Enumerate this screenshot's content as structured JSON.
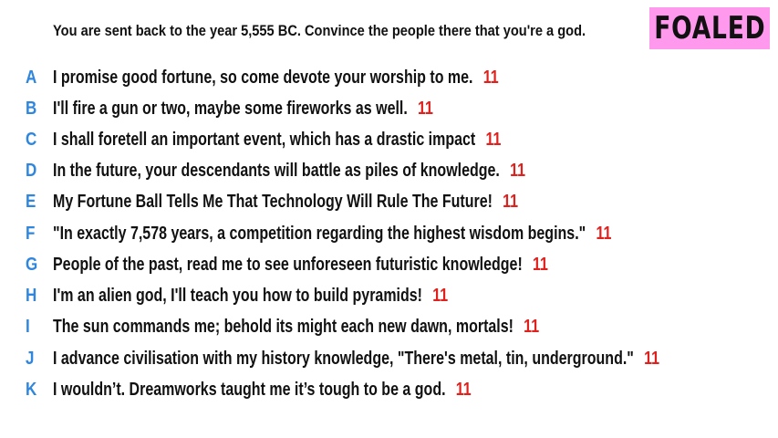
{
  "prompt": "You are sent back to the year 5,555 BC. Convince the people there that you're a god.",
  "badge": "FOALED",
  "colors": {
    "letter": "#2e86de",
    "score": "#e0201c",
    "badge_bg": "#ff99ee"
  },
  "answers": [
    {
      "letter": "A",
      "text": "I promise good fortune, so come devote your worship to me.",
      "score": "11"
    },
    {
      "letter": "B",
      "text": "I'll fire a gun or two, maybe some fireworks as well.",
      "score": "11"
    },
    {
      "letter": "C",
      "text": "I shall foretell an important event, which has a drastic impact",
      "score": "11"
    },
    {
      "letter": "D",
      "text": "In the future, your descendants will battle as piles of knowledge.",
      "score": "11"
    },
    {
      "letter": "E",
      "text": "My Fortune Ball Tells Me That Technology Will Rule The Future!",
      "score": "11"
    },
    {
      "letter": "F",
      "text": "\"In exactly 7,578 years, a competition regarding the highest wisdom begins.\"",
      "score": "11"
    },
    {
      "letter": "G",
      "text": "People of the past, read me to see unforeseen futuristic knowledge!",
      "score": "11"
    },
    {
      "letter": "H",
      "text": "I'm an alien god, I'll teach you how to build pyramids!",
      "score": "11"
    },
    {
      "letter": "I",
      "text": "The sun commands me; behold its might each new dawn, mortals!",
      "score": "11"
    },
    {
      "letter": "J",
      "text": "I advance civilisation with my history knowledge, \"There's metal, tin, underground.\"",
      "score": "11"
    },
    {
      "letter": "K",
      "text": "I wouldn’t. Dreamworks taught me it’s tough to be a god.",
      "score": "11"
    }
  ]
}
